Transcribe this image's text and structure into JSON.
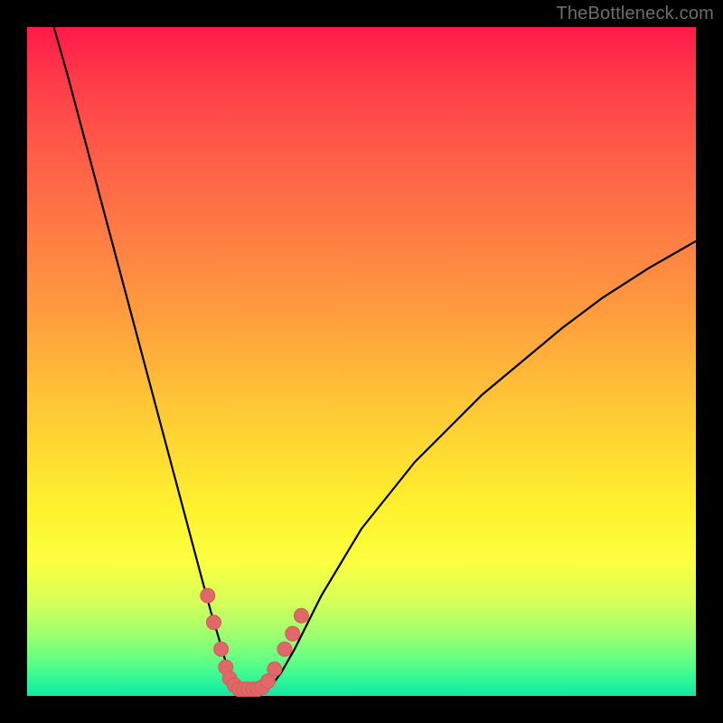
{
  "watermark": "TheBottleneck.com",
  "colors": {
    "background": "#000000",
    "curve_stroke": "#000000",
    "marker_fill": "#e06868",
    "marker_stroke": "#d85a5a"
  },
  "chart_data": {
    "type": "line",
    "title": "",
    "xlabel": "",
    "ylabel": "",
    "xlim": [
      0,
      100
    ],
    "ylim": [
      0,
      100
    ],
    "grid": false,
    "legend": false,
    "series": [
      {
        "name": "curve",
        "x": [
          4,
          6,
          8,
          10,
          12,
          14,
          16,
          18,
          20,
          22,
          24,
          26,
          27.5,
          29,
          30,
          31,
          32,
          33,
          34,
          35,
          36.5,
          38,
          40,
          42,
          44,
          47,
          50,
          54,
          58,
          63,
          68,
          74,
          80,
          86,
          93,
          100
        ],
        "y": [
          100,
          93,
          85.5,
          78,
          70.5,
          63,
          55.5,
          48,
          40.5,
          33,
          25.5,
          18,
          12.5,
          7.5,
          4,
          1.5,
          0.4,
          0,
          0,
          0.4,
          1.5,
          3.5,
          7,
          11,
          15,
          20,
          25,
          30,
          35,
          40,
          45,
          50,
          55,
          59.5,
          64,
          68
        ]
      }
    ],
    "markers": [
      {
        "x": 27.0,
        "y": 15.0
      },
      {
        "x": 27.9,
        "y": 11.0
      },
      {
        "x": 29.0,
        "y": 7.0
      },
      {
        "x": 29.7,
        "y": 4.3
      },
      {
        "x": 30.3,
        "y": 2.6
      },
      {
        "x": 31.0,
        "y": 1.6
      },
      {
        "x": 31.7,
        "y": 1.0
      },
      {
        "x": 32.4,
        "y": 1.0
      },
      {
        "x": 33.1,
        "y": 1.0
      },
      {
        "x": 33.8,
        "y": 1.0
      },
      {
        "x": 34.5,
        "y": 1.0
      },
      {
        "x": 35.2,
        "y": 1.3
      },
      {
        "x": 36.0,
        "y": 2.2
      },
      {
        "x": 37.0,
        "y": 4.0
      },
      {
        "x": 38.5,
        "y": 7.0
      },
      {
        "x": 39.7,
        "y": 9.3
      },
      {
        "x": 41.0,
        "y": 12.0
      }
    ]
  }
}
